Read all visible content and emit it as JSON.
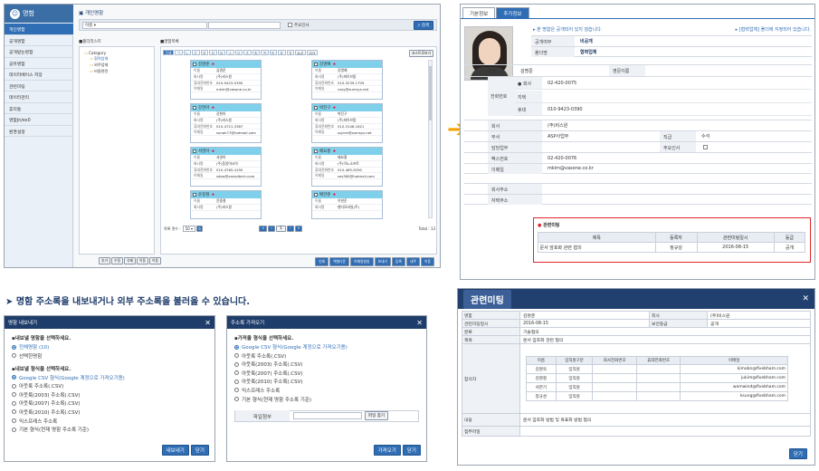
{
  "contacts_app": {
    "brand": "명함",
    "sidebar": [
      "개인명함",
      "공개명함",
      "공개받는명함",
      "공유명함",
      "데이터베이스 저장",
      "관련미팅",
      "데이터관리",
      "휴지통",
      "명함Jn/ex0",
      "환경설정"
    ],
    "breadcrumb": "▣ 개인명함",
    "search_select": "이름",
    "main_checkbox": "주요인사",
    "search_button": "검색",
    "folder_title": "■폴더리스트",
    "folders": [
      "Category",
      "협력업체",
      "외주업체",
      "비용관련"
    ],
    "list_title": "■명함목록",
    "alpha_tabs": [
      "전체",
      "ㄱ",
      "ㄴ",
      "ㄷ",
      "ㄹ",
      "ㅁ",
      "ㅂ",
      "ㅅ",
      "ㅇ",
      "ㅈ",
      "ㅊ",
      "ㅋ",
      "ㅌ",
      "ㅍ",
      "ㅎ",
      "A-Z",
      "123"
    ],
    "view_toggle": "코스트로보기",
    "field_labels": [
      "이름",
      "회사명",
      "휴대전화번호",
      "이메일"
    ],
    "cards": [
      {
        "name": "김명준",
        "vals": [
          "김명준",
          "(주)비스원",
          "010-9423-0390",
          "mkim@vasone.co.kr"
        ]
      },
      {
        "name": "강명예",
        "vals": [
          "강명예",
          "(주)파이브팜",
          "010-3239-1709",
          "cozy@sumsys.net"
        ]
      },
      {
        "name": "강현아",
        "vals": [
          "강현아",
          "(주)비스원",
          "010-4721-3387",
          "sunah77@hotmail.com"
        ]
      },
      {
        "name": "박진구",
        "vals": [
          "박진구",
          "(주)파이브팜",
          "010-3146-1621",
          "sujinrt@sumsys.net"
        ]
      },
      {
        "name": "서영아",
        "vals": [
          "서영아",
          "(주)동양아시아",
          "010-4765-4190",
          "sdsw@vansdtech.com"
        ]
      },
      {
        "name": "배요홍",
        "vals": [
          "배요홍",
          "(주)이노소프트",
          "010-465-9290",
          "ses360@hotmail.com"
        ]
      },
      {
        "name": "윤중철",
        "vals": [
          "윤중철",
          "(주)비스원",
          "",
          ""
        ]
      },
      {
        "name": "배한준",
        "vals": [
          "이한준",
          "팬더모바일(주)",
          "",
          ""
        ]
      }
    ],
    "page_size_label": "목록 갯수 :",
    "page_size_value": "50",
    "current_page": "1",
    "total_label": "Total : 13",
    "folder_buttons": [
      "추가",
      "수정",
      "삭제",
      "이동",
      "이동"
    ],
    "action_buttons": [
      "인쇄",
      "엑셀다운",
      "이메일발송",
      "보내기",
      "등록",
      "내주",
      "이동"
    ]
  },
  "detail": {
    "tabs": [
      "기본정보",
      "추가정보"
    ],
    "notice_left": "▸ 본 명함은 공개되어 있지 않습니다.",
    "notice_right": "▸ [협력업체] 폴더에 지정되어 있습니다.",
    "share_label": "공개여부",
    "share_value": "비공개",
    "folder_label": "폴더명",
    "folder_value": "협력업체",
    "name_label": "이름",
    "name_value": "김명준",
    "english_label": "영문이름",
    "phone_label": "전화번호",
    "phone_rows": [
      {
        "label": "● 회사",
        "value": "02-420-0075"
      },
      {
        "label": "지택",
        "value": ""
      },
      {
        "label": "휴대",
        "value": "010-9423-0390"
      }
    ],
    "company_label": "회사",
    "company_value": "(주)비스원",
    "dept_label": "부서",
    "dept_value": "ASP사업부",
    "position_label": "직급",
    "position_value": "수석",
    "duty_label": "담당업무",
    "key_label": "주요인사",
    "fax_label": "팩스번호",
    "fax_value": "02-420-0076",
    "email_label": "이메일",
    "email_value": "mkim@vasone.co.kr",
    "addr_label": "회사주소",
    "home_addr_label": "자택주소",
    "meeting_title": "관련미팅",
    "meeting_headers": [
      "제목",
      "등록자",
      "관련미팅일시",
      "등급"
    ],
    "meeting_row": [
      "문서 암호화 관련 협의",
      "정규성",
      "2016-08-15",
      "공개"
    ]
  },
  "headline": "➤  명함 주소록을 내보내거나  외부 주소록을 불러올 수 있습니다.",
  "export_dialog": {
    "title": "명함 내보내기",
    "section1": "▪내보낼 명함을 선택하세요.",
    "scope": [
      "전체명함 (10)",
      "선택한명함"
    ],
    "section2": "▪내보낼 형식을 선택하세요.",
    "formats": [
      "Google CSV 형식(Google 계정으로 가져오기용)",
      "아웃룩 주소록(.CSV)",
      "아웃룩(2003) 주소록(.CSV)",
      "아웃룩(2007) 주소록(.CSV)",
      "아웃룩(2010) 주소록(.CSV)",
      "익스프레스 주소록",
      "기본 형식(현재 명함 주소록 기준)"
    ],
    "ok": "내보내기",
    "close": "닫기"
  },
  "import_dialog": {
    "title": "주소록 가져오기",
    "section": "▪가져올 형식을 선택하세요.",
    "formats": [
      "Google CSV 형식(Google 계정으로 가져오기용)",
      "아웃룩 주소록(.CSV)",
      "아웃룩(2003) 주소록(.CSV)",
      "아웃룩(2007) 주소록(.CSV)",
      "아웃룩(2010) 주소록(.CSV)",
      "익스프레스 주소록",
      "기본 형식(현재 명함 주소록 기준)"
    ],
    "file_label": "파일첨부",
    "browse": "파일 찾기",
    "ok": "가져오기",
    "close": "닫기"
  },
  "meeting": {
    "title": "관련미팅",
    "r1": [
      {
        "k": "명함",
        "v": "김명준"
      },
      {
        "k": "회사",
        "v": "(주)비스원"
      }
    ],
    "r2": [
      {
        "k": "관련미팅일시",
        "v": "2016-08-15"
      },
      {
        "k": "보안등급",
        "v": "공개"
      }
    ],
    "type_label": "분류",
    "type_value": "기술협의",
    "subject_label": "제목",
    "subject_value": "문서 암호화 관련 협의",
    "attendees_label": "참석자",
    "att_headers": [
      "이름",
      "임직원구분",
      "회사전화번호",
      "휴대전화번호",
      "이메일"
    ],
    "attendees": [
      [
        "김명욱",
        "임직원",
        "",
        "",
        "kimabn@fivebham.com"
      ],
      [
        "김명철",
        "임직원",
        "",
        "",
        "jukim@fivebham.com"
      ],
      [
        "서한기",
        "임직원",
        "",
        "",
        "wamwind@fivebham.com"
      ],
      [
        "정규성",
        "임직원",
        "",
        "",
        "ksung@fivebham.com"
      ]
    ],
    "content_label": "내용",
    "content_value": "문서 암호화 방법 및 목표화 방법 협의",
    "attach_label": "첨부파일",
    "close": "닫기"
  }
}
